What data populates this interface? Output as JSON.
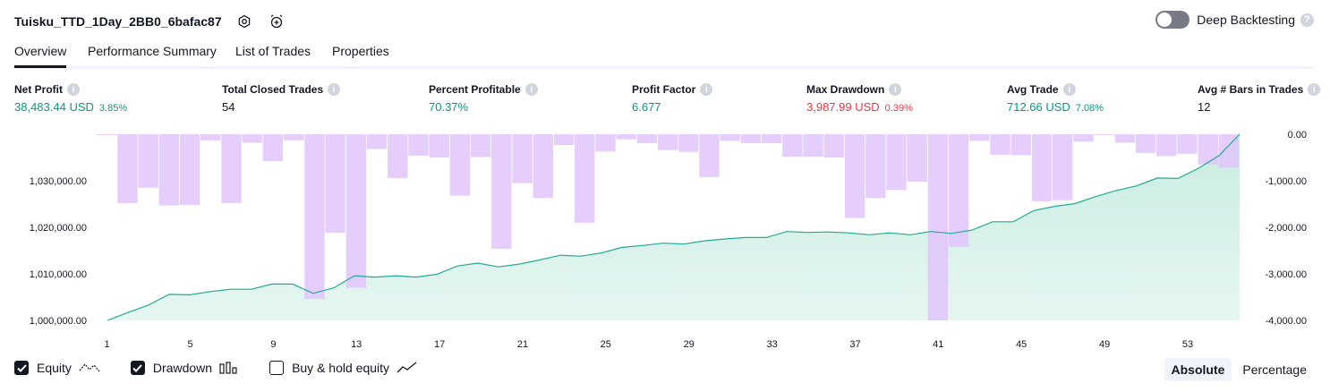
{
  "header": {
    "title": "Tuisku_TTD_1Day_2BB0_6bafac87",
    "settings_icon": "gear-icon",
    "alert_icon": "alarm-clock-add-icon"
  },
  "deep_backtesting": {
    "label": "Deep Backtesting",
    "enabled": false,
    "help": "?"
  },
  "tabs": [
    {
      "label": "Overview",
      "active": true
    },
    {
      "label": "Performance Summary",
      "active": false
    },
    {
      "label": "List of Trades",
      "active": false
    },
    {
      "label": "Properties",
      "active": false
    }
  ],
  "metrics": [
    {
      "label": "Net Profit",
      "value": "38,483.44 USD",
      "pct": "3.85%",
      "color": "green"
    },
    {
      "label": "Total Closed Trades",
      "value": "54",
      "pct": "",
      "color": "dark"
    },
    {
      "label": "Percent Profitable",
      "value": "70.37%",
      "pct": "",
      "color": "green"
    },
    {
      "label": "Profit Factor",
      "value": "6.677",
      "pct": "",
      "color": "green"
    },
    {
      "label": "Max Drawdown",
      "value": "3,987.99 USD",
      "pct": "0.39%",
      "color": "red"
    },
    {
      "label": "Avg Trade",
      "value": "712.66 USD",
      "pct": "7.08%",
      "color": "green"
    },
    {
      "label": "Avg # Bars in Trades",
      "value": "12",
      "pct": "",
      "color": "dark"
    }
  ],
  "info_glyph": "i",
  "colors": {
    "green": "#089981",
    "red": "#f23645",
    "drawdown": "#e1c4fb",
    "equity_line": "#22ab94",
    "equity_fill": "#c8ece1"
  },
  "chart_data": {
    "type": "line",
    "x_ticks": [
      "1",
      "5",
      "9",
      "13",
      "17",
      "21",
      "25",
      "29",
      "33",
      "37",
      "41",
      "45",
      "49",
      "53"
    ],
    "left_axis_ticks": [
      "1,030,000.00",
      "1,020,000.00",
      "1,010,000.00",
      "1,000,000.00"
    ],
    "right_axis_ticks": [
      "0.00",
      "-1,000.00",
      "-2,000.00",
      "-3,000.00",
      "-4,000.00"
    ],
    "left_ylim": [
      1000000,
      1040000
    ],
    "right_ylim": [
      -4000,
      0
    ],
    "series": [
      {
        "name": "Equity",
        "type": "area",
        "axis": "left",
        "values": [
          1000000,
          1001700,
          1003300,
          1005600,
          1005500,
          1006200,
          1006700,
          1006700,
          1007800,
          1007800,
          1005800,
          1007000,
          1009600,
          1009300,
          1009600,
          1009300,
          1009900,
          1011700,
          1012300,
          1011500,
          1012100,
          1013000,
          1014000,
          1013800,
          1014500,
          1015700,
          1016100,
          1016600,
          1016400,
          1017100,
          1017500,
          1017800,
          1017800,
          1019100,
          1018900,
          1019000,
          1018800,
          1018400,
          1018800,
          1018400,
          1019100,
          1018700,
          1019400,
          1021200,
          1021200,
          1023600,
          1024500,
          1025100,
          1026600,
          1027900,
          1028900,
          1030600,
          1030500,
          1032700,
          1035400,
          1040000
        ]
      },
      {
        "name": "Drawdown",
        "type": "bar",
        "axis": "right",
        "values": [
          0,
          -1480,
          -1150,
          -1530,
          -1520,
          -130,
          -1480,
          -180,
          -580,
          -130,
          -3540,
          -2120,
          -3300,
          -320,
          -940,
          -460,
          -500,
          -1320,
          -490,
          -2460,
          -1050,
          -1370,
          -230,
          -1900,
          -370,
          -110,
          -190,
          -340,
          -380,
          -920,
          -140,
          -190,
          -190,
          -480,
          -480,
          -500,
          -1800,
          -1370,
          -1200,
          -1020,
          -4000,
          -2420,
          -140,
          -440,
          -450,
          -1440,
          -1420,
          -160,
          0,
          -180,
          -400,
          -470,
          -420,
          -650,
          -720
        ]
      }
    ]
  },
  "legend": [
    {
      "label": "Equity",
      "checked": true,
      "icon": "equity-line-icon"
    },
    {
      "label": "Drawdown",
      "checked": true,
      "icon": "drawdown-bars-icon"
    },
    {
      "label": "Buy & hold equity",
      "checked": false,
      "icon": "buy-hold-line-icon"
    }
  ],
  "modes": [
    {
      "label": "Absolute",
      "active": true
    },
    {
      "label": "Percentage",
      "active": false
    }
  ]
}
